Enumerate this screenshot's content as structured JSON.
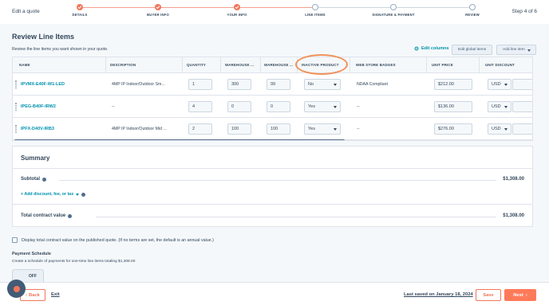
{
  "wizard": {
    "title": "Edit a quote",
    "step_count": "Step 4 of 6",
    "steps": [
      {
        "label": "DETAILS",
        "state": "done"
      },
      {
        "label": "BUYER INFO",
        "state": "done"
      },
      {
        "label": "YOUR INFO",
        "state": "done"
      },
      {
        "label": "LINE ITEMS",
        "state": "current"
      },
      {
        "label": "SIGNATURE & PAYMENT",
        "state": "future"
      },
      {
        "label": "REVIEW",
        "state": "future"
      }
    ]
  },
  "page": {
    "heading": "Review Line Items",
    "subtext": "Review the line items you want shown in your quote.",
    "edit_columns": "Edit columns",
    "edit_global_items": "Edit global items",
    "add_line_item": "Add line item"
  },
  "table": {
    "headers": [
      "NAME",
      "DESCRIPTION",
      "QUANTITY",
      "WAREHOUSE ...",
      "WAREHOUSE ...",
      "INACTIVE PRODUCT",
      "WEB STORE BADGES",
      "UNIT PRICE",
      "UNIT DISCOUNT"
    ],
    "rows": [
      {
        "name": "IPVMX-E40F-W1-LED",
        "description": "4MP IP Indoor/Outdoor Sm...",
        "quantity": "1",
        "wh1": "300",
        "wh2": "99",
        "inactive": "No",
        "badges": "NDAA Compliant",
        "price": "$212.00",
        "currency": "USD"
      },
      {
        "name": "IPEG-B40F-IRW2",
        "description": "--",
        "quantity": "4",
        "wh1": "0",
        "wh2": "0",
        "inactive": "Yes",
        "badges": "--",
        "price": "$136.00",
        "currency": "USD"
      },
      {
        "name": "IPFX-D40V-IRB3",
        "description": "4MP IP Indoor/Outdoor Mid ...",
        "quantity": "2",
        "wh1": "100",
        "wh2": "100",
        "inactive": "Yes",
        "badges": "--",
        "price": "$276.00",
        "currency": "USD"
      }
    ]
  },
  "summary": {
    "title": "Summary",
    "subtotal_label": "Subtotal",
    "subtotal_value": "$1,308.00",
    "add_discount": "+ Add discount, fee, or tax",
    "total_label": "Total contract value",
    "total_value": "$1,308.00"
  },
  "options": {
    "display_total_label": "Display total contract value on the published quote. (If no terms are set, the default is an annual value.)",
    "payment_schedule_heading": "Payment Schedule",
    "payment_schedule_sub": "Create a schedule of payments for one-time line items totaling $1,308.00",
    "toggle_label": "OFF"
  },
  "footer": {
    "back": "Back",
    "exit": "Exit",
    "last_saved": "Last saved on January 18, 2024",
    "save": "Save",
    "next": "Next"
  },
  "colors": {
    "accent": "#ff7a59",
    "link": "#0091ae",
    "highlight": "#f2915a"
  }
}
